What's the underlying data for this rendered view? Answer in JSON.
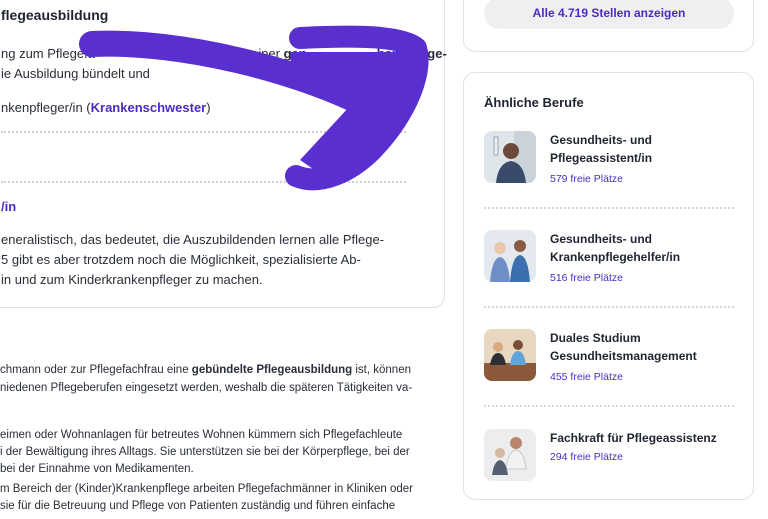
{
  "left_card": {
    "title": "flegeausbildung",
    "para1": {
      "line1_start": "ng zum Pflegefa",
      "line1_mid": "hmen einer ",
      "line1_bold1": "gen",
      "line1_bold2": "hen Pflege-",
      "line2_start": "ie Ausbildung bündelt und",
      "line2_end": "rigen Au"
    },
    "line3_pre": "nkenpfleger/in (",
    "line3_link": "Krankenschwester",
    "line3_post": ")",
    "section_link": "/in",
    "para2": [
      "eneralistisch, das bedeutet, die Auszubildenden lernen alle Pflege-",
      "5 gibt es aber trotzdem noch die Möglichkeit, spezialisierte Ab-",
      "in und zum Kinderkrankenpfleger zu machen."
    ]
  },
  "body": {
    "p1_pre": "chmann oder zur Pflegefachfrau eine ",
    "p1_bold": "gebündelte Pflegeausbildung",
    "p1_post": " ist, können",
    "p1_line2": "niedenen Pflegeberufen eingesetzt werden, weshalb die späteren Tätigkeiten va-",
    "p2": [
      "eimen oder Wohnanlagen für betreutes Wohnen kümmern sich Pflegefachleute",
      "i der Bewältigung ihres Alltags. Sie unterstützen sie bei der Körperpflege, bei der",
      "bei der Einnahme von Medikamenten."
    ],
    "p3": [
      "m Bereich der (Kinder)Krankenpflege arbeiten Pflegefachmänner in Kliniken oder",
      "sie für die Betreuung und Pflege von Patienten zuständig und führen einfache"
    ]
  },
  "sidebar": {
    "show_all_label": "Alle 4.719 Stellen anzeigen",
    "similar_title": "Ähnliche Berufe",
    "items": [
      {
        "name": "Gesundheits- und Pflegeassistent/in",
        "count": "579 freie Plätze"
      },
      {
        "name": "Gesundheits- und Krankenpflegehelfer/in",
        "count": "516 freie Plätze"
      },
      {
        "name": "Duales Studium Gesundheitsmanagement",
        "count": "455 freie Plätze"
      },
      {
        "name": "Fachkraft für Pflegeassistenz",
        "count": "294 freie Plätze"
      }
    ]
  },
  "colors": {
    "accent": "#4b2bc4",
    "arrow": "#5a2fd0",
    "border": "#dfe1e6"
  }
}
